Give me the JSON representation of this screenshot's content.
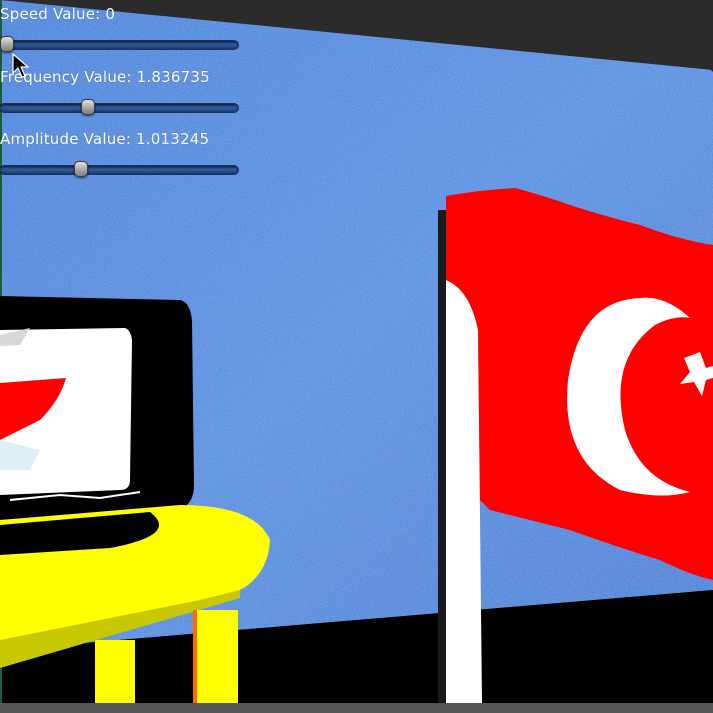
{
  "sliders": [
    {
      "id": "speed",
      "label": "Speed Value: 0",
      "value": 0,
      "min": 0,
      "max": 1,
      "fraction": 0.03
    },
    {
      "id": "frequency",
      "label": "Frequency Value: 1.836735",
      "value": 1.836735,
      "fraction": 0.37
    },
    {
      "id": "amplitude",
      "label": "Amplitude Value: 1.013245",
      "value": 1.013245,
      "fraction": 0.34
    }
  ],
  "colors": {
    "sky": "#3f7fd8",
    "flag_red": "#ff0000",
    "flag_white": "#ffffff",
    "table_yellow": "#ffff00",
    "tv_frame": "#000000",
    "ground": "#000000",
    "pole": "#ffffff"
  },
  "icons": {
    "cursor": "mouse-pointer-icon",
    "flag_emblem": "crescent-star-icon"
  }
}
